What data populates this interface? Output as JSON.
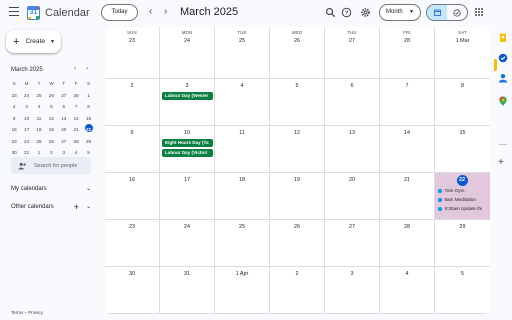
{
  "header": {
    "app_title": "Calendar",
    "logo_day": "31",
    "today_label": "Today",
    "month_title": "March 2025",
    "view_label": "Month",
    "icons": [
      "menu-icon",
      "search-icon",
      "help-icon",
      "settings-icon",
      "calendar-view-icon",
      "tasks-view-icon",
      "apps-icon"
    ]
  },
  "sidebar": {
    "create_label": "Create",
    "mini_calendar": {
      "title": "March 2025",
      "weekday_heads": [
        "S",
        "M",
        "T",
        "W",
        "T",
        "F",
        "S"
      ],
      "weeks": [
        [
          "23",
          "24",
          "25",
          "26",
          "27",
          "28",
          "1"
        ],
        [
          "2",
          "3",
          "4",
          "5",
          "6",
          "7",
          "8"
        ],
        [
          "9",
          "10",
          "11",
          "12",
          "13",
          "14",
          "15"
        ],
        [
          "16",
          "17",
          "18",
          "19",
          "20",
          "21",
          "22"
        ],
        [
          "23",
          "24",
          "25",
          "26",
          "27",
          "28",
          "29"
        ],
        [
          "30",
          "31",
          "1",
          "2",
          "3",
          "4",
          "5"
        ]
      ],
      "today": "22"
    },
    "search_people_placeholder": "Search for people",
    "my_calendars_label": "My calendars",
    "other_calendars_label": "Other calendars",
    "footer": {
      "terms": "Terms",
      "separator": "–",
      "privacy": "Privacy"
    }
  },
  "calendar": {
    "weekdays": [
      "SUN",
      "MON",
      "TUE",
      "WED",
      "THU",
      "FRI",
      "SAT"
    ],
    "weeks": [
      [
        "23",
        "24",
        "25",
        "26",
        "27",
        "28",
        "1 Mar"
      ],
      [
        "2",
        "3",
        "4",
        "5",
        "6",
        "7",
        "8"
      ],
      [
        "9",
        "10",
        "11",
        "12",
        "13",
        "14",
        "15"
      ],
      [
        "16",
        "17",
        "18",
        "19",
        "20",
        "21",
        "22"
      ],
      [
        "23",
        "24",
        "25",
        "26",
        "27",
        "28",
        "29"
      ],
      [
        "30",
        "31",
        "1 Apr",
        "2",
        "3",
        "4",
        "5"
      ]
    ],
    "holiday_events": [
      {
        "week": 1,
        "day": 1,
        "title": "Labour Day (Wester"
      },
      {
        "week": 2,
        "day": 1,
        "title": "Eight Hours Day (Ta"
      },
      {
        "week": 2,
        "day": 1,
        "title": "Labour Day (Victori"
      }
    ],
    "timed_events": [
      {
        "week": 3,
        "day": 6,
        "title": "7am Gym"
      },
      {
        "week": 3,
        "day": 6,
        "title": "8am Meditation"
      },
      {
        "week": 3,
        "day": 6,
        "title": "9:30am Update thi"
      }
    ],
    "colors": {
      "holiday": "#0b8043",
      "today_highlight": "#e2c8dd",
      "today_badge": "#0b57d0",
      "event_dot": "#039be5"
    }
  },
  "side_panel": {
    "icons": [
      "keep-icon",
      "tasks-icon",
      "contacts-icon",
      "maps-icon",
      "add-icon"
    ]
  }
}
